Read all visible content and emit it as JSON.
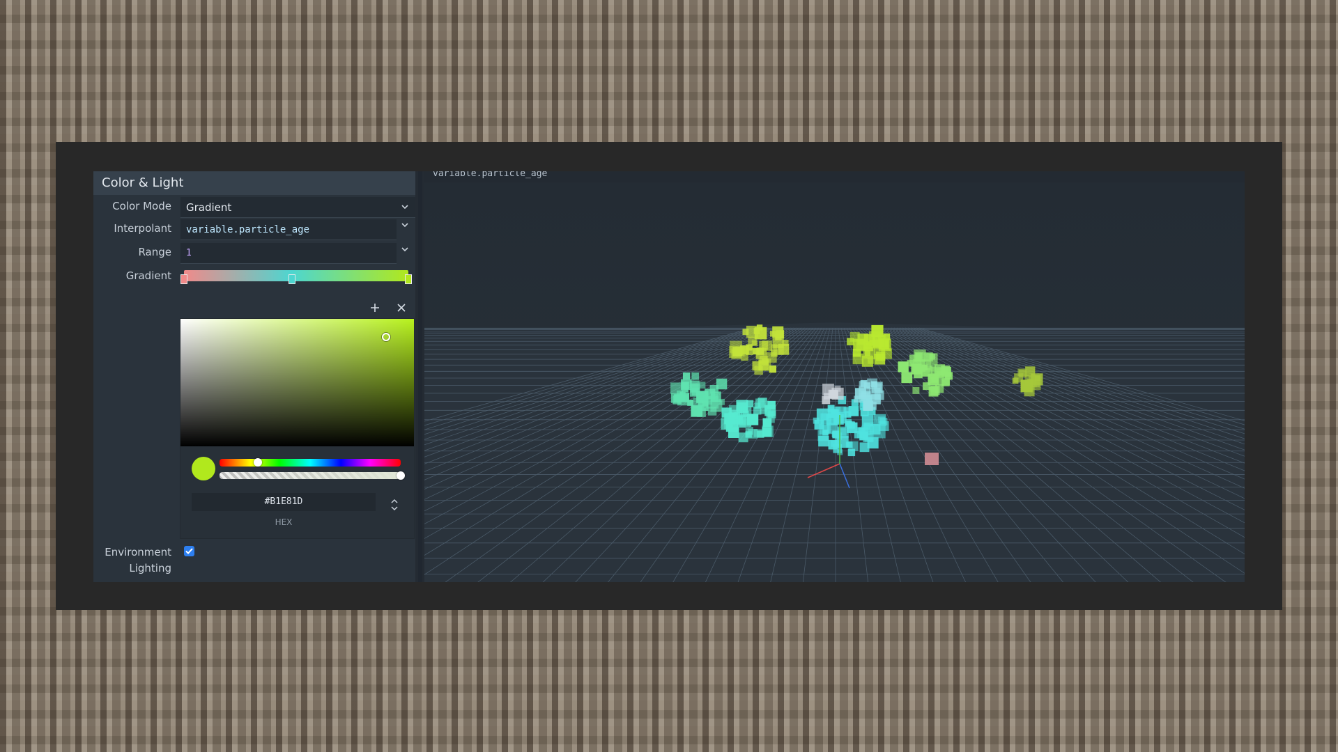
{
  "panel": {
    "title": "Color & Light",
    "color_mode": {
      "label": "Color Mode",
      "value": "Gradient"
    },
    "interpolant": {
      "label": "Interpolant",
      "value": "variable.particle_age"
    },
    "range": {
      "label": "Range",
      "value": "1"
    },
    "gradient": {
      "label": "Gradient",
      "stops": [
        {
          "position": 0.0,
          "color": "#f08a8a"
        },
        {
          "position": 0.48,
          "color": "#4dd6d0"
        },
        {
          "position": 1.0,
          "color": "#b1e81d"
        }
      ]
    },
    "environment_lighting": {
      "label_line1": "Environment",
      "label_line2": "Lighting",
      "checked": true
    }
  },
  "picker": {
    "hex_value": "#B1E81D",
    "hex_label": "HEX",
    "hue_fraction": 0.21,
    "alpha_fraction": 1.0,
    "saturation": 0.88,
    "brightness": 0.91
  },
  "viewport": {
    "expression_text": "variable.particle_age"
  },
  "colors": {
    "accent": "#2d7ff0",
    "selected_color": "#b1e81d",
    "panel_bg": "#2a333c",
    "header_bg": "#36414c"
  },
  "icons": {
    "add": "plus-icon",
    "remove": "close-icon",
    "dropdown": "chevron-down-icon",
    "spinner": "up-down-chevron-icon",
    "checkbox": "check-icon"
  }
}
